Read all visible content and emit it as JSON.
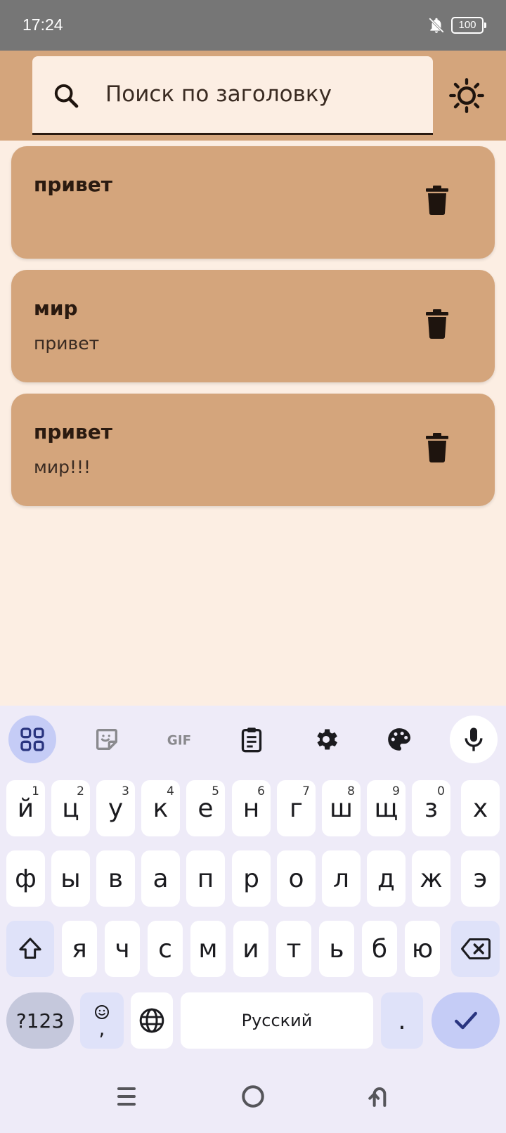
{
  "status": {
    "time": "17:24",
    "battery": "100"
  },
  "search": {
    "placeholder": "Поиск по заголовку"
  },
  "notes": [
    {
      "title": "привет",
      "body": ""
    },
    {
      "title": "мир",
      "body": "привет"
    },
    {
      "title": "привет",
      "body": "мир!!!"
    }
  ],
  "keyboard": {
    "row1": [
      "й",
      "ц",
      "у",
      "к",
      "е",
      "н",
      "г",
      "ш",
      "щ",
      "з",
      "х"
    ],
    "row1_hints": [
      "1",
      "2",
      "3",
      "4",
      "5",
      "6",
      "7",
      "8",
      "9",
      "0",
      ""
    ],
    "row2": [
      "ф",
      "ы",
      "в",
      "а",
      "п",
      "р",
      "о",
      "л",
      "д",
      "ж",
      "э"
    ],
    "row3": [
      "я",
      "ч",
      "с",
      "м",
      "и",
      "т",
      "ь",
      "б",
      "ю"
    ],
    "sym_label": "?123",
    "emoji_comma": ",",
    "space_label": "Русский",
    "period": "."
  },
  "colors": {
    "accent": "#D4A57C",
    "background": "#FCEEE3",
    "text": "#2A1A10"
  }
}
